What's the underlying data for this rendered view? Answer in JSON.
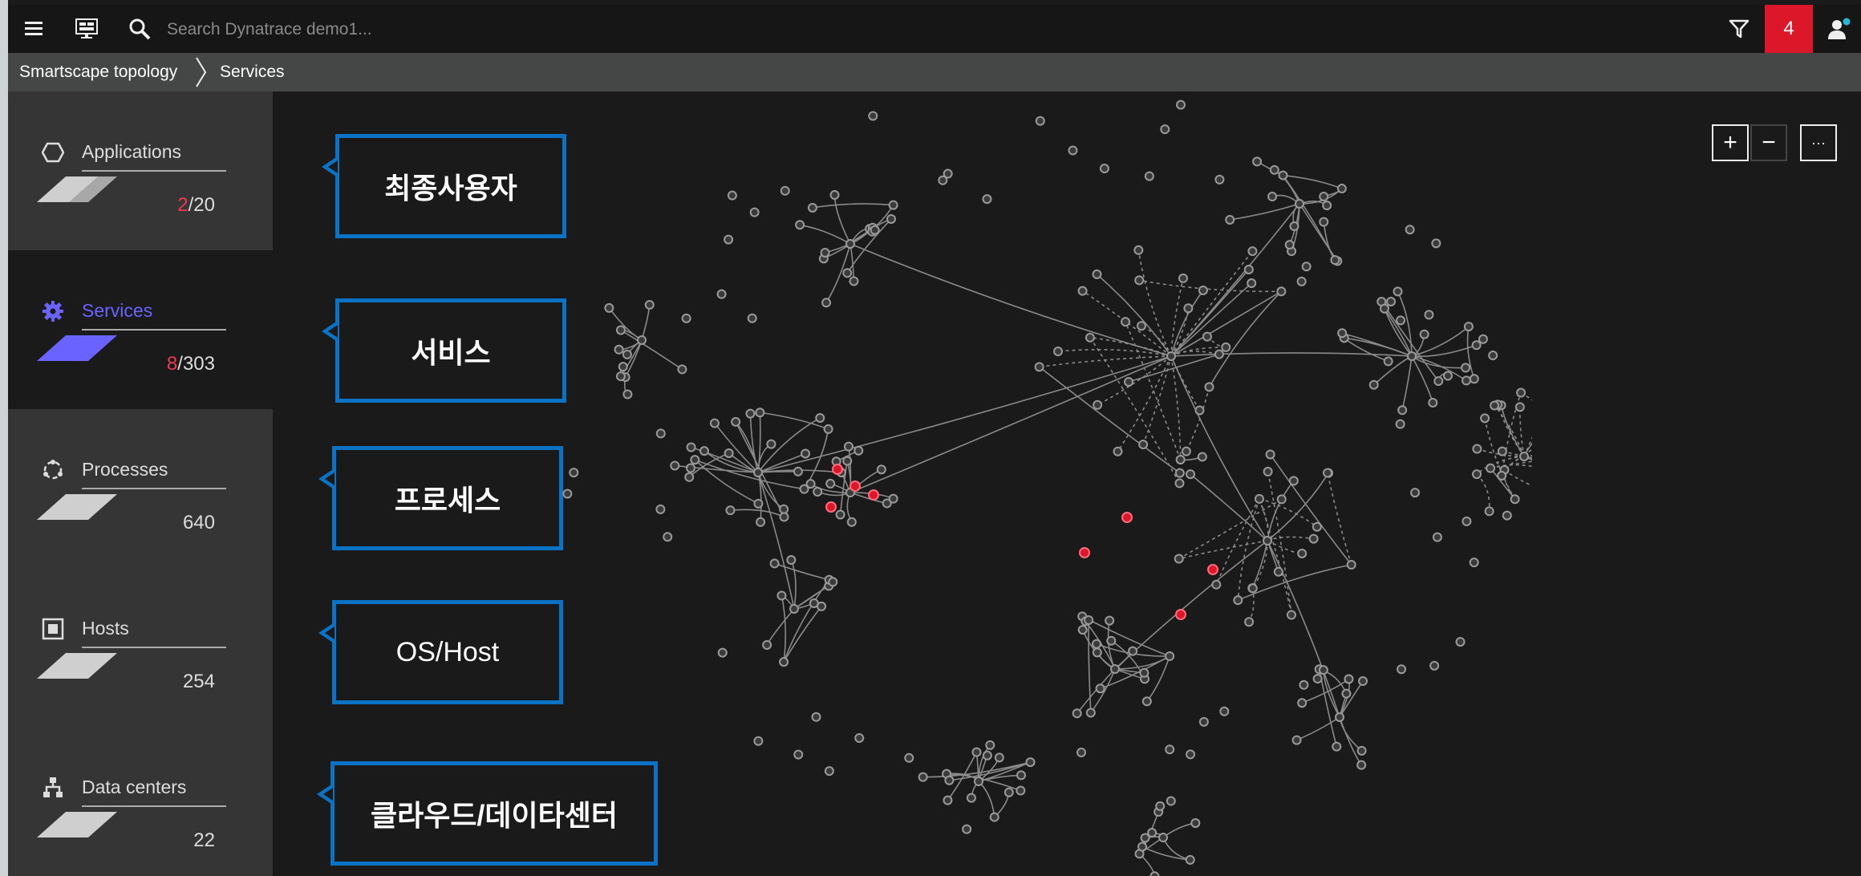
{
  "search": {
    "placeholder": "Search Dynatrace demo1..."
  },
  "topbar": {
    "alert_count": "4"
  },
  "breadcrumb": {
    "items": [
      "Smartscape topology",
      "Services"
    ]
  },
  "sidebar": {
    "items": [
      {
        "label": "Applications",
        "count_problem": "2",
        "count_total": "/20",
        "icon": "hexagon-icon"
      },
      {
        "label": "Services",
        "count_problem": "8",
        "count_total": "/303",
        "icon": "gear-icon",
        "active": true
      },
      {
        "label": "Processes",
        "count_problem": "",
        "count_total": "640",
        "icon": "process-icon"
      },
      {
        "label": "Hosts",
        "count_problem": "",
        "count_total": "254",
        "icon": "host-icon"
      },
      {
        "label": "Data centers",
        "count_problem": "",
        "count_total": "22",
        "icon": "datacenter-icon"
      }
    ]
  },
  "callouts": [
    "최종사용자",
    "서비스",
    "프로세스",
    "OS/Host",
    "클라우드/데이타센터"
  ],
  "zoom": {
    "plus": "+",
    "minus": "−",
    "more": "···"
  },
  "colors": {
    "accent": "#6b63ff",
    "problem": "#dc172a",
    "callout_border": "#0a73c6"
  }
}
